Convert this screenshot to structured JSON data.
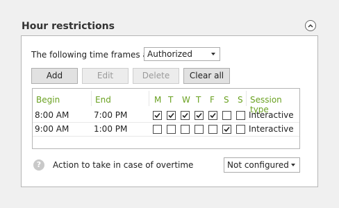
{
  "section": {
    "title": "Hour restrictions"
  },
  "timeframes": {
    "label": "The following time frames are",
    "value": "Authorized"
  },
  "buttons": {
    "add": "Add",
    "edit": "Edit",
    "delete": "Delete",
    "clear_all": "Clear all"
  },
  "grid": {
    "headers": {
      "begin": "Begin",
      "end": "End",
      "days": [
        "M",
        "T",
        "W",
        "T",
        "F",
        "S",
        "S"
      ],
      "session_type": "Session type"
    },
    "rows": [
      {
        "begin": "8:00 AM",
        "end": "7:00 PM",
        "days": [
          true,
          true,
          true,
          true,
          true,
          false,
          false
        ],
        "session_type": "Interactive"
      },
      {
        "begin": "9:00 AM",
        "end": "1:00 PM",
        "days": [
          false,
          false,
          false,
          false,
          false,
          true,
          false
        ],
        "session_type": "Interactive"
      }
    ]
  },
  "overtime": {
    "label": "Action to take in case of overtime",
    "value": "Not configured"
  },
  "colors": {
    "header_text": "#6aa121"
  },
  "icons": {
    "collapse": "chevron-up-circle-icon",
    "help": "help-icon",
    "check": "check-icon"
  }
}
